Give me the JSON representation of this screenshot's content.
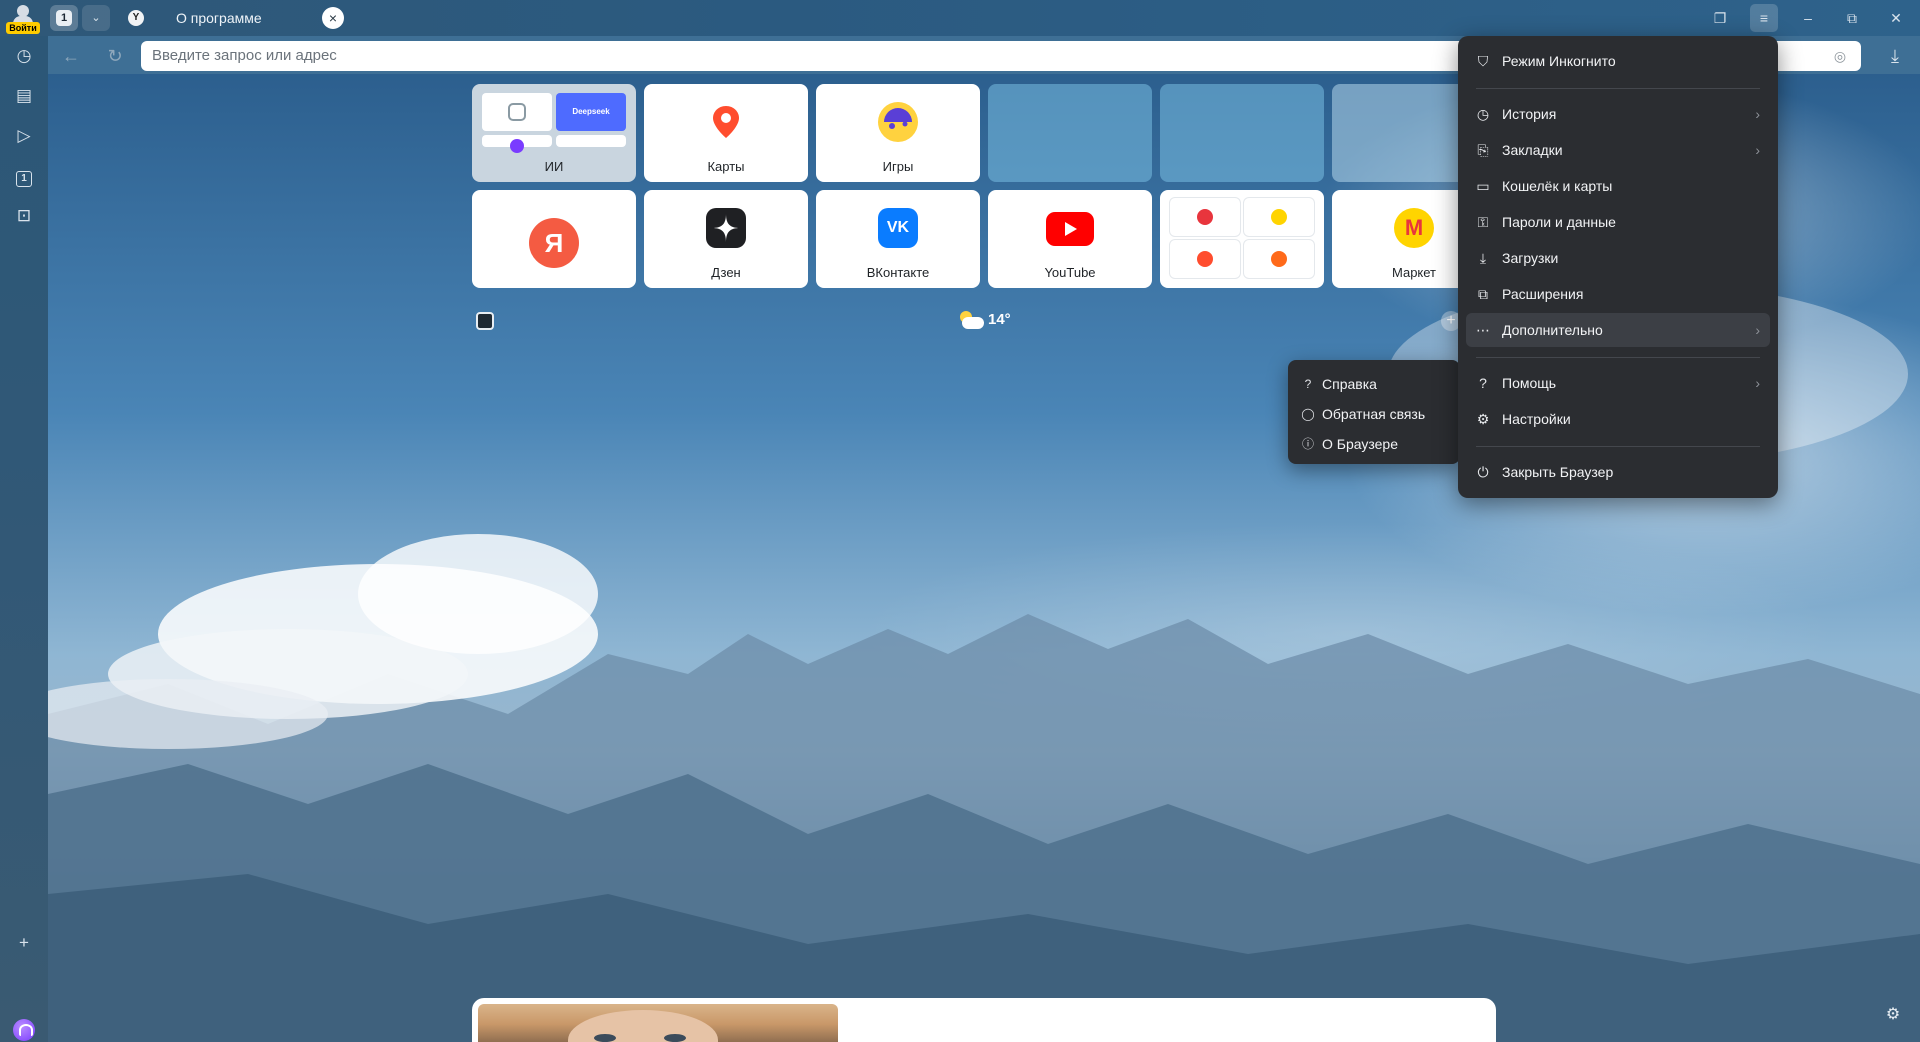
{
  "profile": {
    "login_label": "Войти"
  },
  "tabs_button": {
    "count": "1"
  },
  "tab": {
    "favicon": "Y",
    "title": "О программе",
    "close_icon": "×"
  },
  "address_bar": {
    "placeholder": "Введите запрос или адрес"
  },
  "tiles_row1": [
    {
      "label": "ИИ",
      "mini_label": "Deepseek"
    },
    {
      "label": "Карты"
    },
    {
      "label": "Игры"
    },
    {
      "label": ""
    },
    {
      "label": ""
    },
    {
      "label": ""
    }
  ],
  "tiles_row2": [
    {
      "label": "",
      "logo": "Я"
    },
    {
      "label": "Дзен"
    },
    {
      "label": "ВКонтакте",
      "logo": "VK"
    },
    {
      "label": "YouTube"
    },
    {
      "label": ""
    },
    {
      "label": "Маркет",
      "logo": "M"
    }
  ],
  "weather": {
    "temp": "14°"
  },
  "menu": {
    "items": [
      {
        "label": "Режим Инкогнито",
        "icon": "incognito-shield-icon"
      },
      {
        "label": "История",
        "icon": "clock-icon",
        "submenu": true
      },
      {
        "label": "Закладки",
        "icon": "bookmark-icon",
        "submenu": true
      },
      {
        "label": "Кошелёк и карты",
        "icon": "wallet-icon"
      },
      {
        "label": "Пароли и данные",
        "icon": "key-icon"
      },
      {
        "label": "Загрузки",
        "icon": "download-icon"
      },
      {
        "label": "Расширения",
        "icon": "puzzle-icon"
      },
      {
        "label": "Дополнительно",
        "icon": "more-dots-icon",
        "submenu": true
      },
      {
        "label": "Помощь",
        "icon": "question-icon",
        "submenu": true
      },
      {
        "label": "Настройки",
        "icon": "gear-icon"
      },
      {
        "label": "Закрыть Браузер",
        "icon": "power-icon"
      }
    ]
  },
  "submenu": {
    "items": [
      {
        "label": "Справка",
        "icon": "question-icon"
      },
      {
        "label": "Обратная связь",
        "icon": "chat-bubble-icon"
      },
      {
        "label": "О Браузере",
        "icon": "info-icon"
      }
    ]
  },
  "colors": {
    "menu_bg": "#2b2d31",
    "menu_highlight": "#3c3f45",
    "accent_yellow": "#ffcc00"
  }
}
